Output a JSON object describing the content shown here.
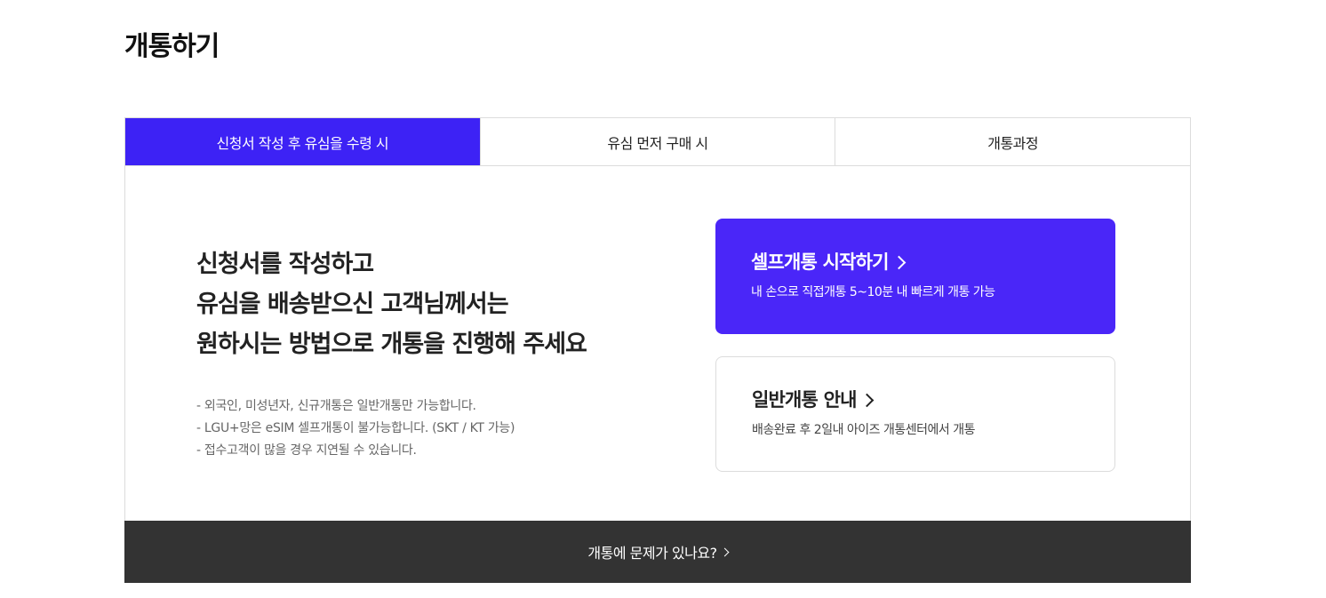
{
  "page": {
    "title": "개통하기"
  },
  "tabs": [
    {
      "label": "신청서 작성 후 유심을 수령 시",
      "active": true
    },
    {
      "label": "유심 먼저 구매 시",
      "active": false
    },
    {
      "label": "개통과정",
      "active": false
    }
  ],
  "main": {
    "headline_lines": [
      "신청서를 작성하고",
      "유심을 배송받으신 고객님께서는",
      "원하시는 방법으로 개통을 진행해 주세요"
    ],
    "notes": [
      "-  외국인, 미성년자, 신규개통은 일반개통만 가능합니다.",
      "- LGU+망은 eSIM 셀프개통이 불가능합니다. (SKT / KT 가능)",
      "- 접수고객이 많을 경우 지연될 수 있습니다."
    ]
  },
  "cards": {
    "self": {
      "title": "셀프개통 시작하기",
      "desc": "내 손으로 직접개통 5~10분 내 빠르게 개통 가능",
      "icon": "chevron-right-icon",
      "color": "#4a26f8"
    },
    "general": {
      "title": "일반개통 안내",
      "desc": "배송완료 후 2일내 아이즈 개통센터에서 개통",
      "icon": "chevron-right-icon"
    }
  },
  "footer": {
    "label": "개통에 문제가 있나요?",
    "icon": "chevron-right-icon"
  },
  "colors": {
    "accent": "#3d22f5",
    "footer_bg": "#333333",
    "border": "#dcdcdc"
  }
}
